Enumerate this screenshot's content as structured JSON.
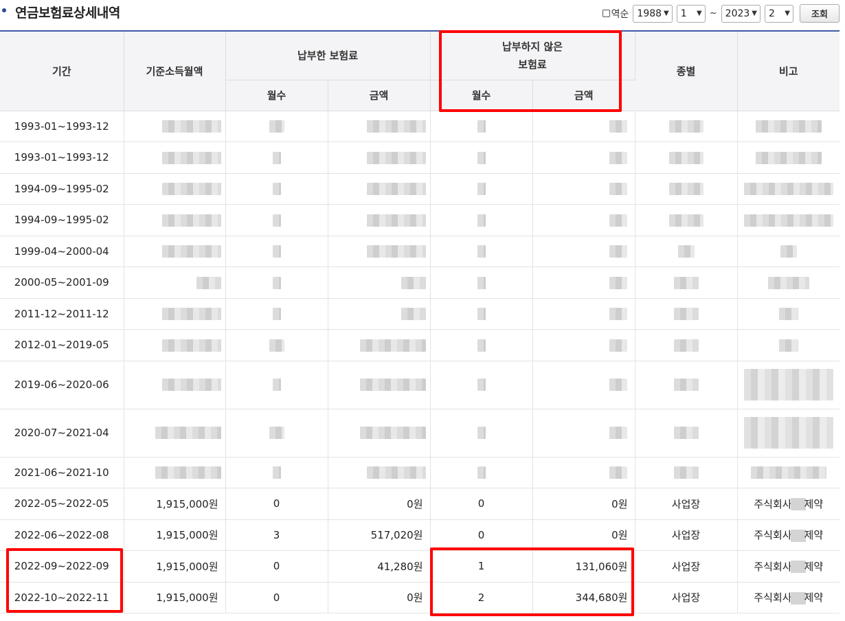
{
  "header": {
    "title": "연금보험료상세내역",
    "reverse_label": "역순",
    "from_year": "1988",
    "from_month": "1",
    "range_sep": "~",
    "to_year": "2023",
    "to_month": "2",
    "search_label": "조회"
  },
  "table": {
    "headers": {
      "period": "기간",
      "base_income": "기준소득월액",
      "paid": "납부한 보험료",
      "unpaid_line1": "납부하지 않은",
      "unpaid_line2": "보험료",
      "months": "월수",
      "amount": "금액",
      "type": "종별",
      "note": "비고"
    },
    "rows": [
      {
        "period": "1993-01~1993-12",
        "masked": true
      },
      {
        "period": "1993-01~1993-12",
        "masked": true
      },
      {
        "period": "1994-09~1995-02",
        "masked": true
      },
      {
        "period": "1994-09~1995-02",
        "masked": true
      },
      {
        "period": "1999-04~2000-04",
        "masked": true
      },
      {
        "period": "2000-05~2001-09",
        "masked": true
      },
      {
        "period": "2011-12~2011-12",
        "masked": true
      },
      {
        "period": "2012-01~2019-05",
        "masked": true
      },
      {
        "period": "2019-06~2020-06",
        "masked": true
      },
      {
        "period": "2020-07~2021-04",
        "masked": true
      },
      {
        "period": "2021-06~2021-10",
        "masked": true
      },
      {
        "period": "2022-05~2022-05",
        "base_income": "1,915,000원",
        "paid_months": "0",
        "paid_amount": "0원",
        "unpaid_months": "0",
        "unpaid_amount": "0원",
        "type": "사업장",
        "note_prefix": "주식회사",
        "note_suffix": "제약"
      },
      {
        "period": "2022-06~2022-08",
        "base_income": "1,915,000원",
        "paid_months": "3",
        "paid_amount": "517,020원",
        "unpaid_months": "0",
        "unpaid_amount": "0원",
        "type": "사업장",
        "note_prefix": "주식회사",
        "note_suffix": "제약"
      },
      {
        "period": "2022-09~2022-09",
        "base_income": "1,915,000원",
        "paid_months": "0",
        "paid_amount": "41,280원",
        "unpaid_months": "1",
        "unpaid_amount": "131,060원",
        "type": "사업장",
        "note_prefix": "주식회사",
        "note_suffix": "제약"
      },
      {
        "period": "2022-10~2022-11",
        "base_income": "1,915,000원",
        "paid_months": "0",
        "paid_amount": "0원",
        "unpaid_months": "2",
        "unpaid_amount": "344,680원",
        "type": "사업장",
        "note_prefix": "주식회사",
        "note_suffix": "제약"
      }
    ]
  },
  "colors": {
    "highlight": "#ff0000",
    "header_line": "#3d5aa8"
  }
}
